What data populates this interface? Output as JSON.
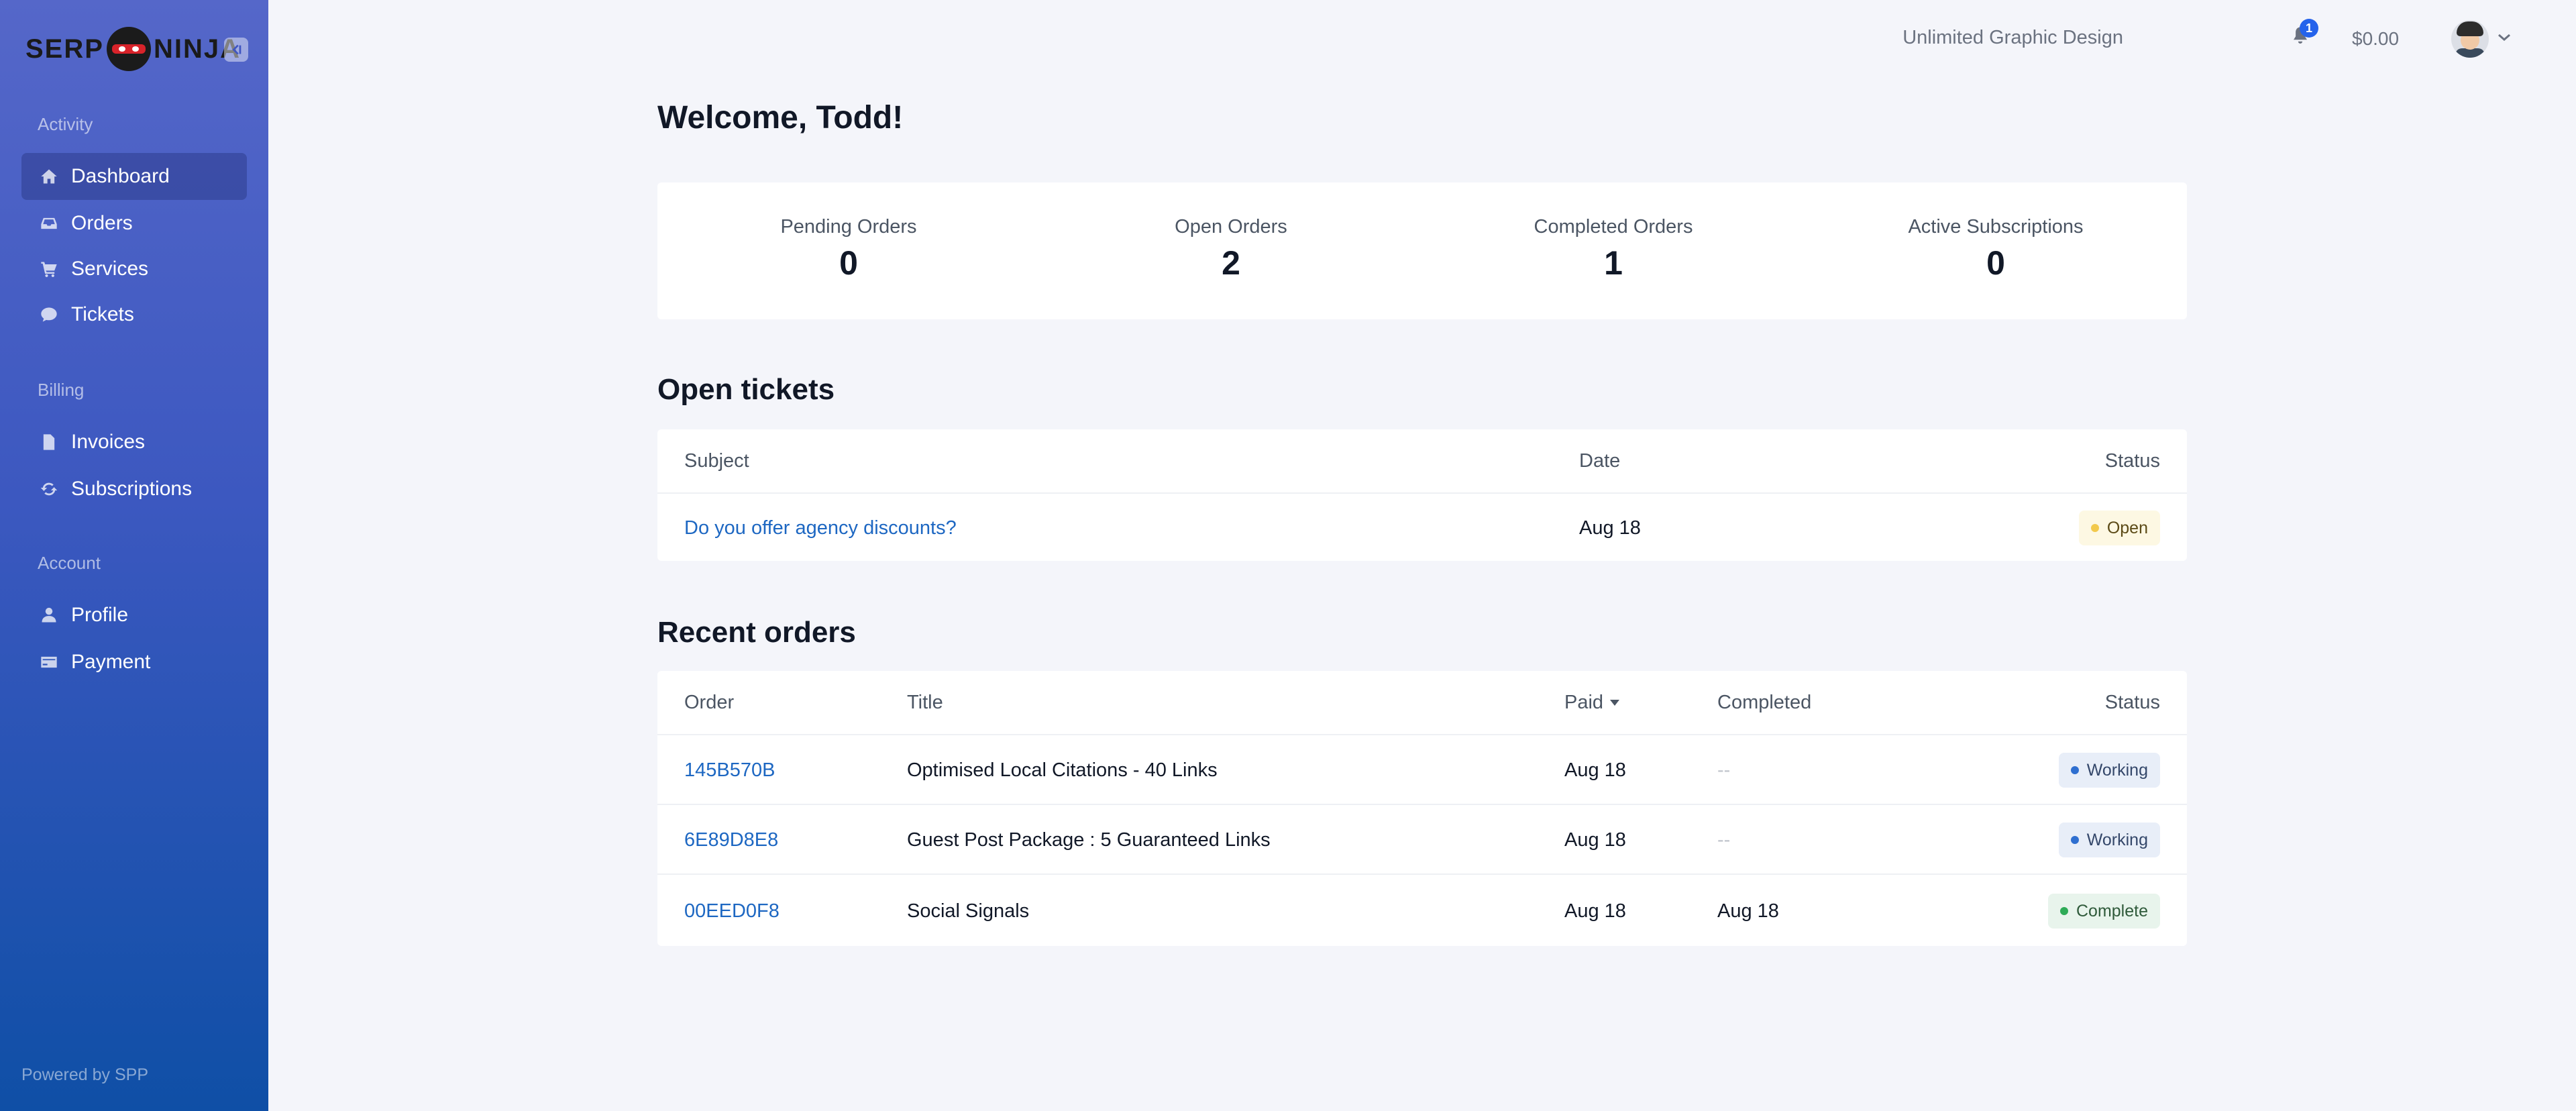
{
  "logo": {
    "text_left": "SERP",
    "text_right": "NINJA"
  },
  "sidebar": {
    "sections": [
      {
        "title": "Activity"
      },
      {
        "title": "Billing"
      },
      {
        "title": "Account"
      }
    ],
    "items": [
      {
        "label": "Dashboard",
        "icon": "home-icon"
      },
      {
        "label": "Orders",
        "icon": "inbox-icon"
      },
      {
        "label": "Services",
        "icon": "cart-icon"
      },
      {
        "label": "Tickets",
        "icon": "chat-icon"
      },
      {
        "label": "Invoices",
        "icon": "document-icon"
      },
      {
        "label": "Subscriptions",
        "icon": "refresh-icon"
      },
      {
        "label": "Profile",
        "icon": "user-icon"
      },
      {
        "label": "Payment",
        "icon": "credit-card-icon"
      }
    ],
    "powered_by": "Powered by SPP"
  },
  "topbar": {
    "company": "Unlimited Graphic Design",
    "notifications_count": "1",
    "balance": "$0.00"
  },
  "main": {
    "welcome": "Welcome, Todd!",
    "stats": [
      {
        "label": "Pending Orders",
        "value": "0"
      },
      {
        "label": "Open Orders",
        "value": "2"
      },
      {
        "label": "Completed Orders",
        "value": "1"
      },
      {
        "label": "Active Subscriptions",
        "value": "0"
      }
    ],
    "open_tickets": {
      "heading": "Open tickets",
      "columns": {
        "subject": "Subject",
        "date": "Date",
        "status": "Status"
      },
      "rows": [
        {
          "subject": "Do you offer agency discounts?",
          "date": "Aug 18",
          "status": "Open"
        }
      ]
    },
    "recent_orders": {
      "heading": "Recent orders",
      "columns": {
        "order": "Order",
        "title": "Title",
        "paid": "Paid",
        "completed": "Completed",
        "status": "Status"
      },
      "rows": [
        {
          "order": "145B570B",
          "title": "Optimised Local Citations - 40 Links",
          "paid": "Aug 18",
          "completed": "--",
          "status": "Working"
        },
        {
          "order": "6E89D8E8",
          "title": "Guest Post Package : 5 Guaranteed Links",
          "paid": "Aug 18",
          "completed": "--",
          "status": "Working"
        },
        {
          "order": "00EED0F8",
          "title": "Social Signals",
          "paid": "Aug 18",
          "completed": "Aug 18",
          "status": "Complete"
        }
      ]
    }
  },
  "colors": {
    "sidebar_top": "#5567c9",
    "sidebar_bottom": "#0f4fa6",
    "link": "#1d67c2",
    "badge_open_dot": "#f2c94c",
    "badge_working_dot": "#2f6fd0",
    "badge_complete_dot": "#2eab57"
  }
}
